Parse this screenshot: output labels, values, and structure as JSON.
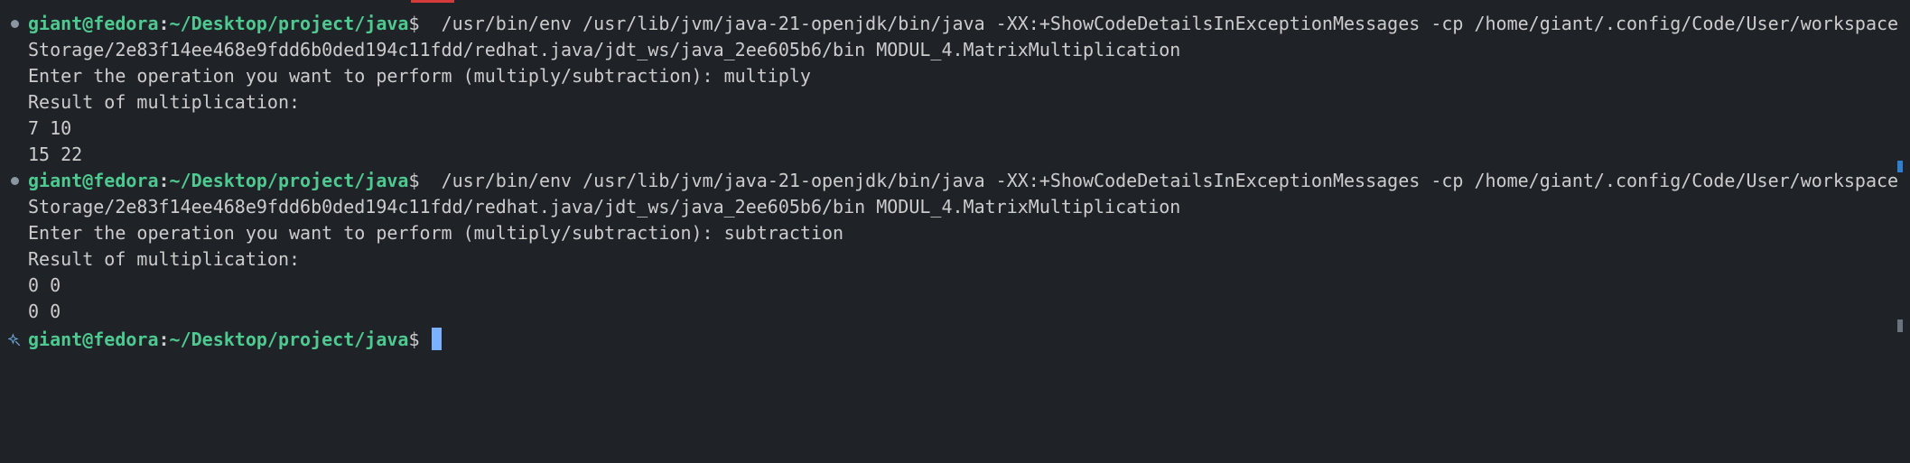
{
  "terminal": {
    "prompt": {
      "user_host": "giant@fedora",
      "separator": ":",
      "path": "~/Desktop/project/java",
      "symbol": "$"
    },
    "run1": {
      "command": "  /usr/bin/env /usr/lib/jvm/java-21-openjdk/bin/java -XX:+ShowCodeDetailsInExceptionMessages -cp /home/giant/.config/Code/User/workspace",
      "command_cont": "Storage/2e83f14ee468e9fdd6b0ded194c11fdd/redhat.java/jdt_ws/java_2ee605b6/bin MODUL_4.MatrixMultiplication",
      "input_line": "Enter the operation you want to perform (multiply/subtraction): multiply",
      "result_label": "Result of multiplication:",
      "row1": "7 10",
      "row2": "15 22"
    },
    "run2": {
      "command": "  /usr/bin/env /usr/lib/jvm/java-21-openjdk/bin/java -XX:+ShowCodeDetailsInExceptionMessages -cp /home/giant/.config/Code/User/workspace",
      "command_cont": "Storage/2e83f14ee468e9fdd6b0ded194c11fdd/redhat.java/jdt_ws/java_2ee605b6/bin MODUL_4.MatrixMultiplication",
      "input_line": "Enter the operation you want to perform (multiply/subtraction): subtraction",
      "result_label": "Result of multiplication:",
      "row1": "0 0",
      "row2": "0 0"
    },
    "icons": {
      "command_marker": "circle-dot-icon",
      "active_marker": "sparkle-icon"
    },
    "colors": {
      "background": "#1f2328",
      "prompt_green": "#4ec98f",
      "cursor_blue": "#7ab2ff",
      "text": "#cccccc"
    }
  }
}
